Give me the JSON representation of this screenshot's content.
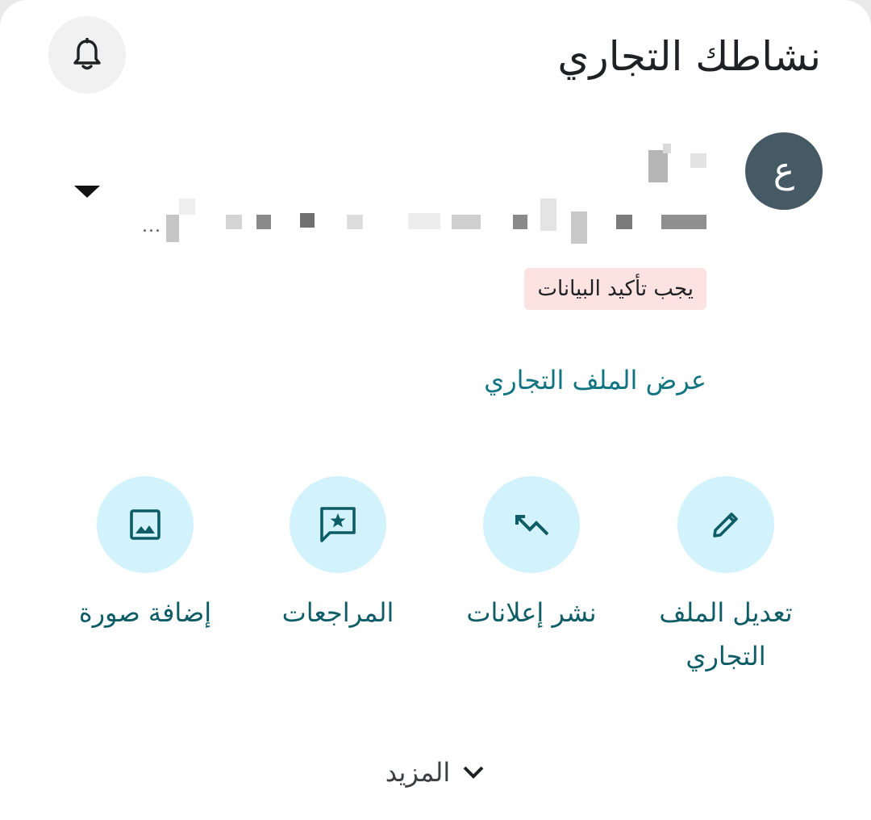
{
  "header": {
    "title": "نشاطك التجاري",
    "notifications_icon": "bell-icon"
  },
  "business": {
    "avatar_letter": "ع",
    "verify_badge": "يجب تأكيد البيانات",
    "view_profile_link": "عرض الملف التجاري",
    "address_ellipsis": "..."
  },
  "actions": [
    {
      "label": "تعديل الملف التجاري",
      "icon": "pencil-icon"
    },
    {
      "label": "نشر إعلانات",
      "icon": "trending-icon"
    },
    {
      "label": "المراجعات",
      "icon": "review-star-icon"
    },
    {
      "label": "إضافة صورة",
      "icon": "image-icon"
    }
  ],
  "footer": {
    "more_label": "المزيد",
    "more_icon": "chevron-down-icon"
  },
  "colors": {
    "accent_text": "#127481",
    "action_circle": "#d2f3fb",
    "avatar_bg": "#455a64",
    "badge_bg": "#fce3e1"
  }
}
